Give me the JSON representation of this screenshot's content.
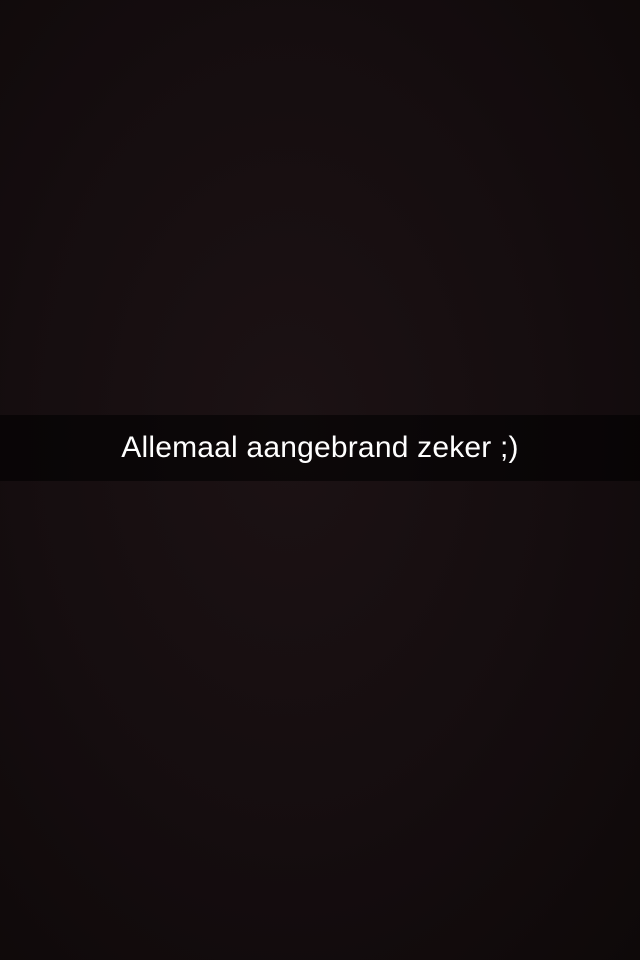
{
  "caption": {
    "text": "Allemaal aangebrand zeker ;)"
  },
  "colors": {
    "background": "#150d0f",
    "caption_text": "#ffffff"
  }
}
